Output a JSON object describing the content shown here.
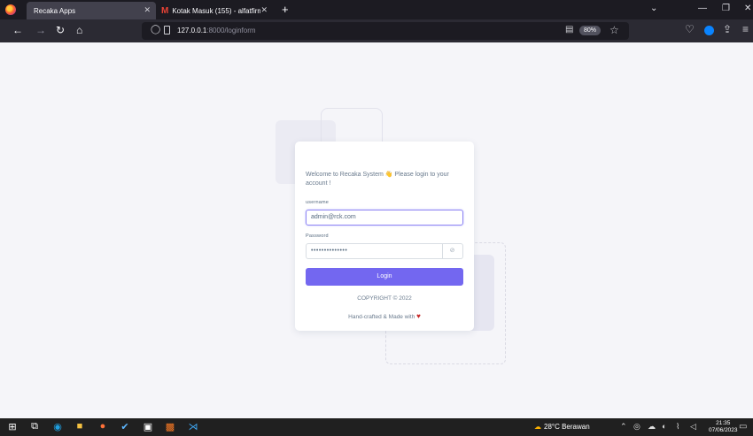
{
  "browser": {
    "tabs": [
      {
        "label": "Recaka Apps",
        "active": true
      },
      {
        "label": "Kotak Masuk (155) - alfatfirman",
        "active": false
      }
    ],
    "url_host": "127.0.0.1",
    "url_path": ":8000/loginform",
    "zoom": "80%"
  },
  "login": {
    "welcome": "Welcome to Recaka System 👋 Please login to your account !",
    "username_label": "username",
    "username_value": "admin@rck.com",
    "password_label": "Password",
    "password_value": "••••••••••••••",
    "login_button": "Login",
    "copyright": "COPYRIGHT © 2022",
    "handcrafted": "Hand-crafted & Made with"
  },
  "taskbar": {
    "weather": "28°C Berawan",
    "time": "21:35",
    "date": "07/06/2023"
  },
  "colors": {
    "accent": "#7367f0",
    "heart": "#c62828"
  }
}
